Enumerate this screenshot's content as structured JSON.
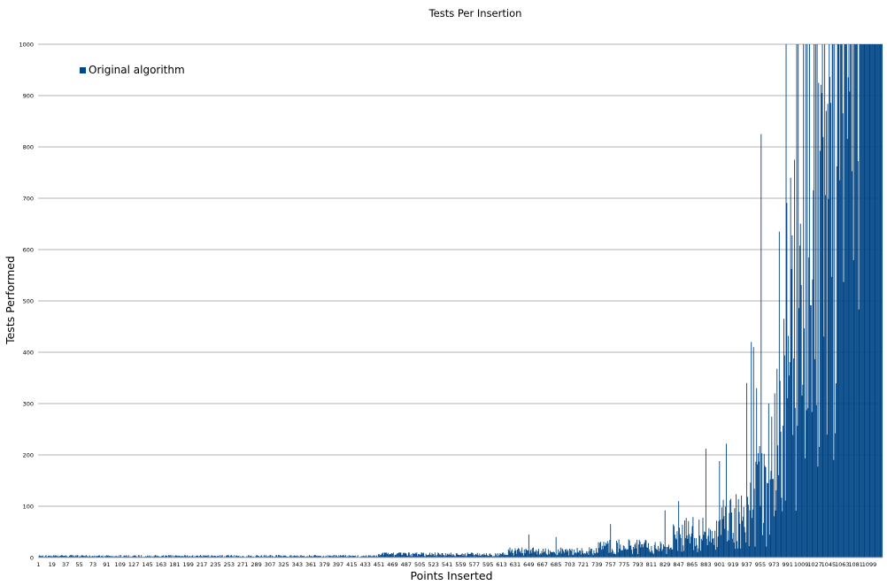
{
  "chart_data": {
    "type": "bar",
    "title": "Tests Per Insertion",
    "xlabel": "Points Inserted",
    "ylabel": "Tests Performed",
    "ylim": [
      0,
      1000
    ],
    "yticks": [
      0,
      100,
      200,
      300,
      400,
      500,
      600,
      700,
      800,
      900,
      1000
    ],
    "x_range": [
      1,
      1116
    ],
    "xtick_labels": [
      "1",
      "19",
      "37",
      "55",
      "73",
      "91",
      "109",
      "127",
      "145",
      "163",
      "181",
      "199",
      "217",
      "235",
      "253",
      "271",
      "289",
      "307",
      "325",
      "343",
      "361",
      "379",
      "397",
      "415",
      "433",
      "451",
      "469",
      "487",
      "505",
      "523",
      "541",
      "559",
      "577",
      "595",
      "613",
      "631",
      "649",
      "667",
      "685",
      "703",
      "721",
      "739",
      "757",
      "775",
      "793",
      "811",
      "829",
      "847",
      "865",
      "883",
      "901",
      "919",
      "937",
      "955",
      "973",
      "991",
      "1009",
      "1027",
      "1045",
      "1063",
      "1081",
      "1099"
    ],
    "grid": true,
    "legend_position": "top-left",
    "series": [
      {
        "name": "Original algorithm",
        "color": "#004586",
        "notable_points": [
          {
            "x": 649,
            "y": 45
          },
          {
            "x": 685,
            "y": 40
          },
          {
            "x": 757,
            "y": 65
          },
          {
            "x": 829,
            "y": 92
          },
          {
            "x": 847,
            "y": 110
          },
          {
            "x": 883,
            "y": 212
          },
          {
            "x": 901,
            "y": 188
          },
          {
            "x": 910,
            "y": 222
          },
          {
            "x": 937,
            "y": 340
          },
          {
            "x": 943,
            "y": 420
          },
          {
            "x": 946,
            "y": 410
          },
          {
            "x": 950,
            "y": 330
          },
          {
            "x": 956,
            "y": 825
          },
          {
            "x": 966,
            "y": 300
          },
          {
            "x": 980,
            "y": 635
          },
          {
            "x": 986,
            "y": 465
          },
          {
            "x": 989,
            "y": 1000
          },
          {
            "x": 995,
            "y": 740
          },
          {
            "x": 1000,
            "y": 775
          },
          {
            "x": 1005,
            "y": 1000
          },
          {
            "x": 1012,
            "y": 1000
          },
          {
            "x": 1020,
            "y": 1000
          },
          {
            "x": 1030,
            "y": 1000
          },
          {
            "x": 1036,
            "y": 905
          },
          {
            "x": 1042,
            "y": 870
          },
          {
            "x": 1050,
            "y": 1000
          },
          {
            "x": 1058,
            "y": 1000
          },
          {
            "x": 1066,
            "y": 1000
          },
          {
            "x": 1075,
            "y": 1000
          },
          {
            "x": 1083,
            "y": 1000
          },
          {
            "x": 1092,
            "y": 1000
          },
          {
            "x": 1100,
            "y": 1000
          },
          {
            "x": 1116,
            "y": 1000
          }
        ]
      }
    ]
  }
}
